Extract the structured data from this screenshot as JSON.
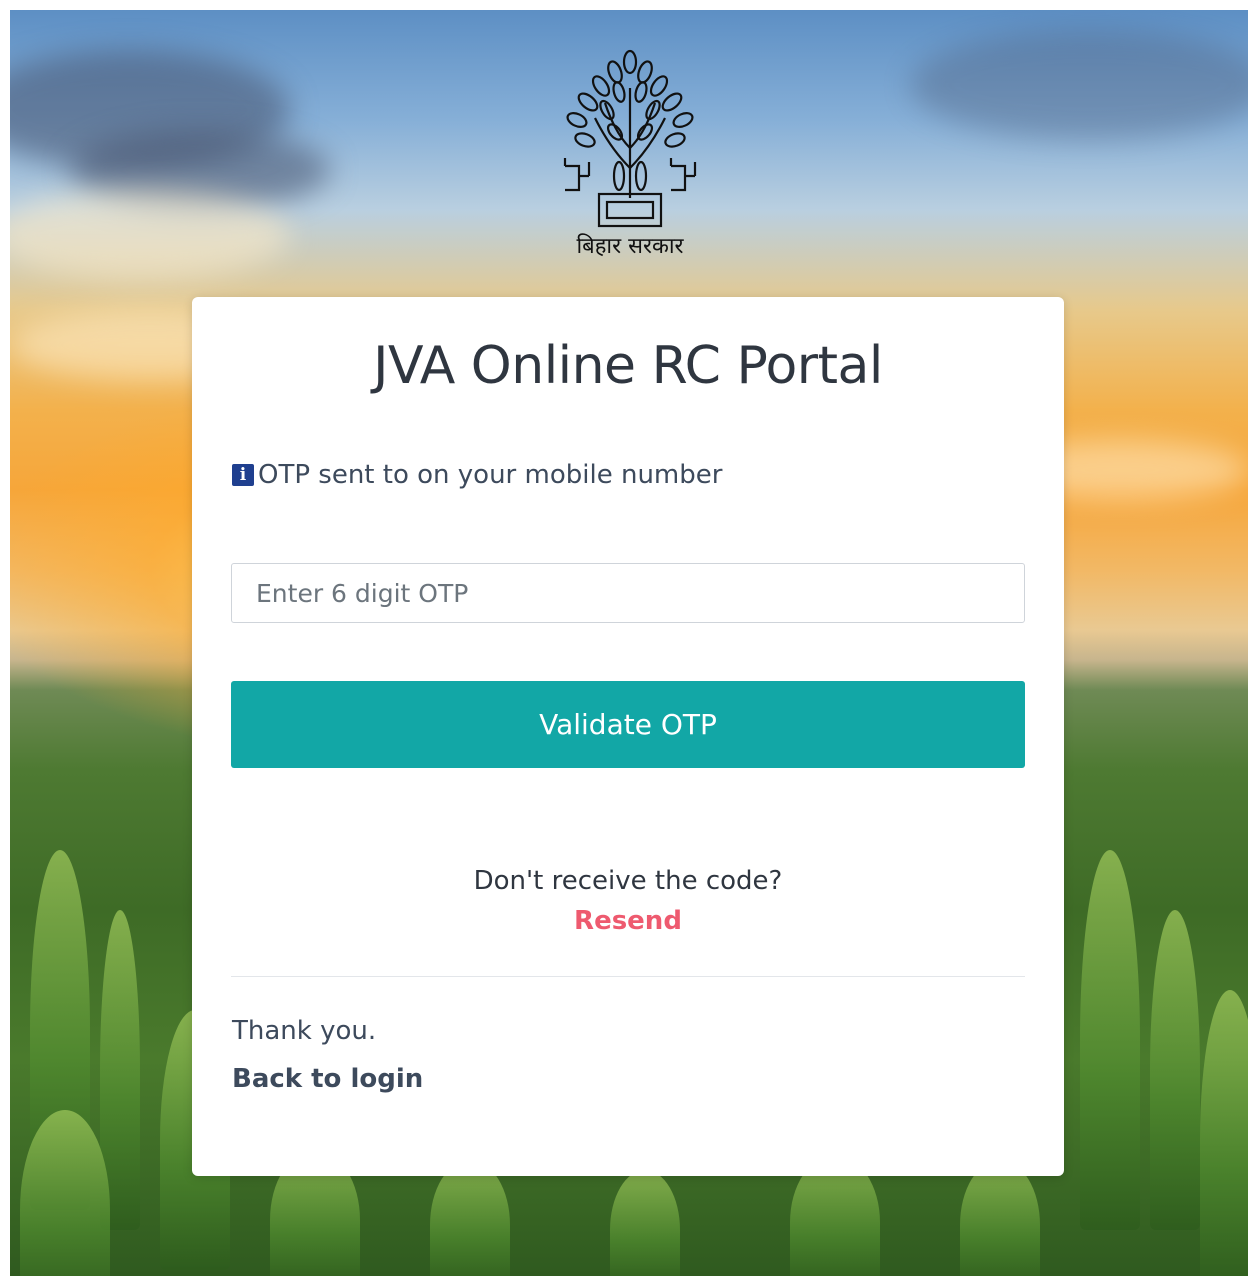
{
  "header": {
    "emblem_icon": "bihar-government-emblem-icon",
    "emblem_text": "बिहार सरकार"
  },
  "card": {
    "title": "JVA Online RC Portal",
    "info": {
      "icon": "info-icon",
      "icon_glyph": "i",
      "text": "OTP sent to on your mobile number"
    },
    "otp_input": {
      "value": "",
      "placeholder": "Enter 6 digit OTP"
    },
    "validate_button": "Validate OTP",
    "no_code_text": "Don't receive the code?",
    "resend_link": "Resend",
    "thanks_text": "Thank you.",
    "back_to_login": "Back to login"
  },
  "colors": {
    "primary_button": "#12a7a6",
    "resend_link": "#ee5a6f",
    "info_icon": "#1f3f8f",
    "text": "#3d4a5c"
  }
}
